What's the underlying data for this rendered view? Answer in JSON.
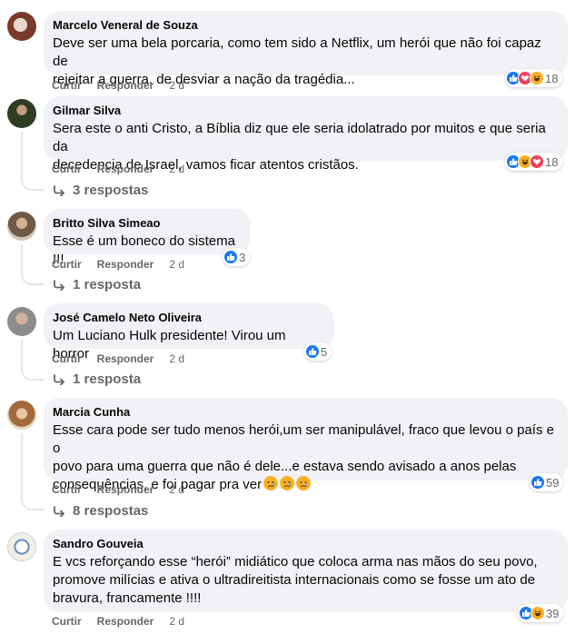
{
  "comments": [
    {
      "author": "Marcelo Veneral de Souza",
      "lines": [
        "Deve ser uma bela porcaria, como tem sido a Netflix, um herói que não foi capaz de",
        "rejeitar a guerra, de desviar a nação da tragédia..."
      ],
      "like_label": "Curtir",
      "reply_label": "Responder",
      "time": "2 d",
      "reaction_icons": [
        "like-icon",
        "love-icon",
        "haha-icon"
      ],
      "reaction_count": "18"
    },
    {
      "author": "Gilmar Silva",
      "lines": [
        "Sera este o anti Cristo, a Bíblia diz que ele seria idolatrado por muitos e que seria da",
        "decedencia de Israel, vamos ficar atentos cristãos."
      ],
      "like_label": "Curtir",
      "reply_label": "Responder",
      "time": "2 d",
      "reaction_icons": [
        "like-icon",
        "haha-icon",
        "love-icon"
      ],
      "reaction_count": "18",
      "replies": "3 respostas"
    },
    {
      "author": "Britto Silva Simeao",
      "lines": [
        "Esse é um boneco do sistema !!!"
      ],
      "like_label": "Curtir",
      "reply_label": "Responder",
      "time": "2 d",
      "reaction_icons": [
        "like-icon"
      ],
      "reaction_count": "3",
      "replies": "1 resposta"
    },
    {
      "author": "José Camelo Neto Oliveira",
      "lines": [
        "Um Luciano Hulk presidente! Virou um horror"
      ],
      "like_label": "Curtir",
      "reply_label": "Responder",
      "time": "2 d",
      "reaction_icons": [
        "like-icon"
      ],
      "reaction_count": "5",
      "replies": "1 resposta"
    },
    {
      "author": "Marcia Cunha",
      "lines": [
        "Esse cara pode ser tudo menos herói,um ser manipulável, fraco que levou o país e o",
        "povo para uma guerra que não é dele...e estava sendo avisado a anos pelas",
        "consequências, e foi pagar pra ver"
      ],
      "like_label": "Curtir",
      "reply_label": "Responder",
      "time": "2 d",
      "reaction_icons": [
        "like-icon"
      ],
      "reaction_count": "59",
      "replies": "8 respostas"
    },
    {
      "author": "Sandro Gouveia",
      "lines": [
        "E vcs reforçando esse “herói” midiático que coloca arma nas mãos do seu povo,",
        "promove milícias e ativa o ultradireitista internacionais como se fosse um ato de",
        "bravura, francamente !!!!"
      ],
      "like_label": "Curtir",
      "reply_label": "Responder",
      "time": "2 d",
      "reaction_icons": [
        "like-icon",
        "haha-icon"
      ],
      "reaction_count": "39"
    }
  ],
  "colors": {
    "bubble": "#f0f2f5",
    "meta": "#65676b",
    "like": "#1877f2",
    "love": "#f33e58",
    "haha": "#f7b125"
  }
}
